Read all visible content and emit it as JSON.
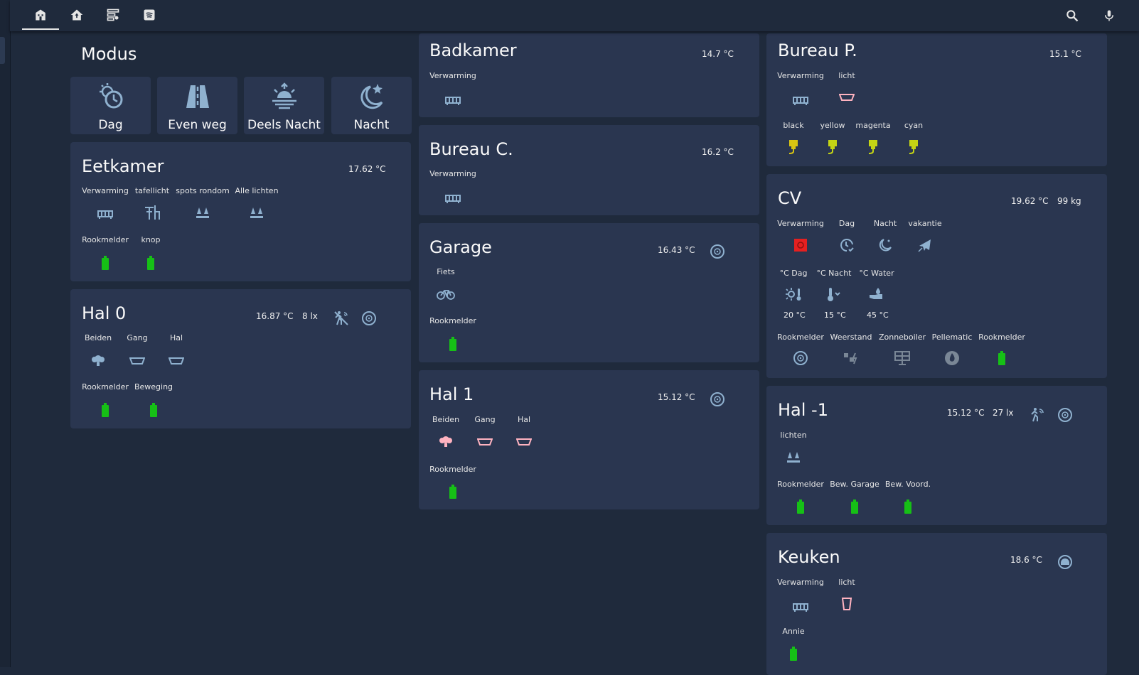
{
  "colors": {
    "background": "#1f2a3c",
    "card": "#2a3650",
    "icon": "#8fb1cf",
    "light_on": "#ffb3c0",
    "plug": "#d8c412",
    "battery": "#16c016",
    "alert": "#e52020"
  },
  "toolbar": {
    "tabs": [
      "home-icon",
      "house-icon",
      "dashboard-icon",
      "spotify-icon"
    ],
    "actions": [
      "search-icon",
      "microphone-icon"
    ]
  },
  "modus": {
    "title": "Modus",
    "buttons": [
      {
        "label": "Dag",
        "icon": "clock-sun-icon"
      },
      {
        "label": "Even weg",
        "icon": "road-icon"
      },
      {
        "label": "Deels Nacht",
        "icon": "sunset-icon"
      },
      {
        "label": "Nacht",
        "icon": "moon-icon"
      }
    ]
  },
  "eetkamer": {
    "title": "Eetkamer",
    "temp": "17.62 °C",
    "row1": [
      {
        "label": "Verwarming",
        "icon": "radiator-icon"
      },
      {
        "label": "tafellicht",
        "icon": "table-lamp-icon"
      },
      {
        "label": "spots rondom",
        "icon": "spotlights-icon"
      },
      {
        "label": "Alle lichten",
        "icon": "spotlights-icon"
      }
    ],
    "row2": [
      {
        "label": "Rookmelder",
        "icon": "battery-icon"
      },
      {
        "label": "knop",
        "icon": "battery-icon"
      }
    ]
  },
  "hal0": {
    "title": "Hal 0",
    "temp": "16.87 °C",
    "lux": "8 lx",
    "row1": [
      {
        "label": "Beiden",
        "icon": "bulbs-icon"
      },
      {
        "label": "Gang",
        "icon": "ceiling-light-icon"
      },
      {
        "label": "Hal",
        "icon": "ceiling-light-icon"
      }
    ],
    "row2": [
      {
        "label": "Rookmelder",
        "icon": "battery-icon"
      },
      {
        "label": "Beweging",
        "icon": "battery-icon"
      }
    ]
  },
  "badkamer": {
    "title": "Badkamer",
    "temp": "14.7 °C",
    "row1": [
      {
        "label": "Verwarming",
        "icon": "radiator-icon"
      }
    ]
  },
  "bureauc": {
    "title": "Bureau C.",
    "temp": "16.2 °C",
    "row1": [
      {
        "label": "Verwarming",
        "icon": "radiator-icon"
      }
    ]
  },
  "garage": {
    "title": "Garage",
    "temp": "16.43 °C",
    "row1": [
      {
        "label": "Fiets",
        "icon": "bicycle-icon"
      }
    ],
    "row2": [
      {
        "label": "Rookmelder",
        "icon": "battery-icon"
      }
    ]
  },
  "hal1": {
    "title": "Hal 1",
    "temp": "15.12 °C",
    "row1": [
      {
        "label": "Beiden",
        "icon": "bulbs-icon"
      },
      {
        "label": "Gang",
        "icon": "ceiling-light-icon"
      },
      {
        "label": "Hal",
        "icon": "ceiling-light-icon"
      }
    ],
    "row2": [
      {
        "label": "Rookmelder",
        "icon": "battery-icon"
      }
    ]
  },
  "bureaup": {
    "title": "Bureau P.",
    "temp": "15.1 °C",
    "row1": [
      {
        "label": "Verwarming",
        "icon": "radiator-icon"
      },
      {
        "label": "licht",
        "icon": "ceiling-light-icon"
      }
    ],
    "row2": [
      {
        "label": "black",
        "icon": "plug-icon"
      },
      {
        "label": "yellow",
        "icon": "plug-icon"
      },
      {
        "label": "magenta",
        "icon": "plug-icon"
      },
      {
        "label": "cyan",
        "icon": "plug-icon"
      }
    ]
  },
  "cv": {
    "title": "CV",
    "temp": "19.62 °C",
    "weight": "99 kg",
    "row1": [
      {
        "label": "Verwarming",
        "icon": "fire-alert-icon"
      },
      {
        "label": "Dag",
        "icon": "clock-check-icon"
      },
      {
        "label": "Nacht",
        "icon": "moon-icon"
      },
      {
        "label": "vakantie",
        "icon": "airplane-icon"
      }
    ],
    "row2": [
      {
        "label": "°C Dag",
        "icon": "sun-thermometer-icon",
        "value": "20 °C"
      },
      {
        "label": "°C Nacht",
        "icon": "thermometer-down-icon",
        "value": "15 °C"
      },
      {
        "label": "°C Water",
        "icon": "water-hand-icon",
        "value": "45 °C"
      }
    ],
    "row3": [
      {
        "label": "Rookmelder",
        "icon": "smoke-detector-icon"
      },
      {
        "label": "Weerstand",
        "icon": "resistor-icon"
      },
      {
        "label": "Zonneboiler",
        "icon": "solar-panel-icon"
      },
      {
        "label": "Pellematic",
        "icon": "flame-icon"
      },
      {
        "label": "Rookmelder",
        "icon": "battery-icon"
      }
    ]
  },
  "halmin1": {
    "title": "Hal -1",
    "temp": "15.12 °C",
    "lux": "27 lx",
    "row1": [
      {
        "label": "lichten",
        "icon": "spotlights-icon"
      }
    ],
    "row2": [
      {
        "label": "Rookmelder",
        "icon": "battery-icon"
      },
      {
        "label": "Bew. Garage",
        "icon": "battery-icon"
      },
      {
        "label": "Bew. Voord.",
        "icon": "battery-icon"
      }
    ]
  },
  "keuken": {
    "title": "Keuken",
    "temp": "18.6 °C",
    "row1": [
      {
        "label": "Verwarming",
        "icon": "radiator-icon"
      },
      {
        "label": "licht",
        "icon": "pendant-light-icon"
      }
    ],
    "row2": [
      {
        "label": "Annie",
        "icon": "battery-icon"
      }
    ]
  }
}
